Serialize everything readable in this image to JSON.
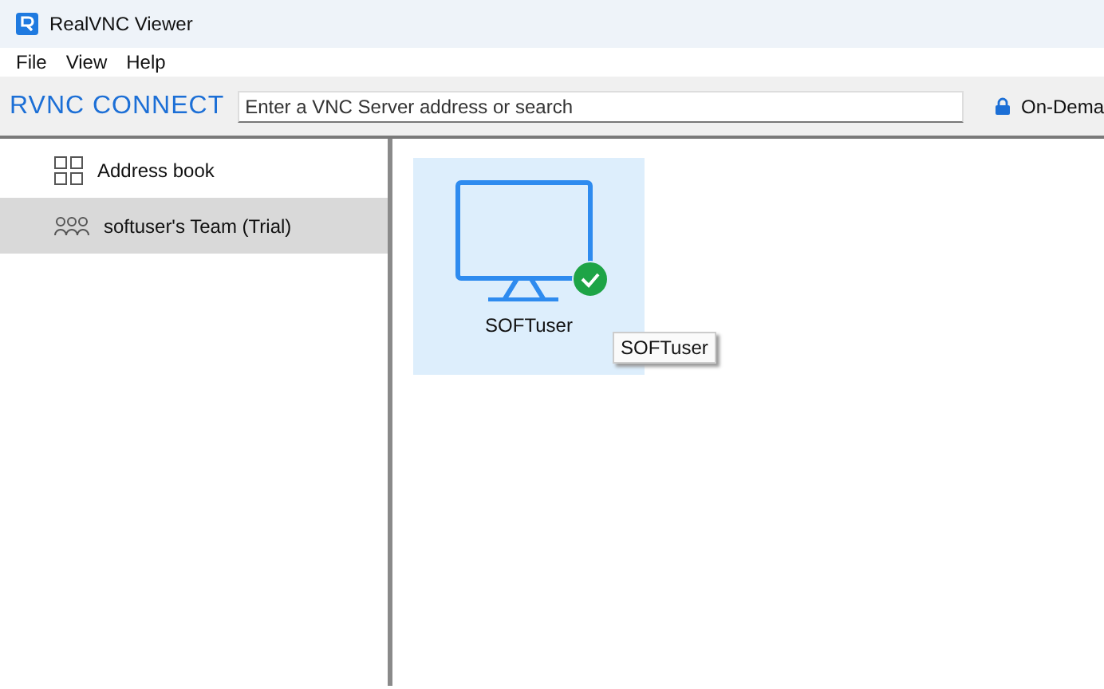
{
  "window": {
    "title": "RealVNC Viewer"
  },
  "menu": [
    "File",
    "View",
    "Help"
  ],
  "toolbar": {
    "logo": "RVNC CONNECT",
    "search": {
      "placeholder": "Enter a VNC Server address or search"
    },
    "mode": "On-Dema"
  },
  "sidebar": {
    "items": [
      {
        "label": "Address book",
        "kind": "book",
        "selected": false
      },
      {
        "label": "softuser's Team (Trial)",
        "kind": "team",
        "selected": true
      }
    ]
  },
  "computers": [
    {
      "name": "SOFTuser",
      "online": true,
      "selected": true
    }
  ],
  "tooltip": "SOFTuser"
}
